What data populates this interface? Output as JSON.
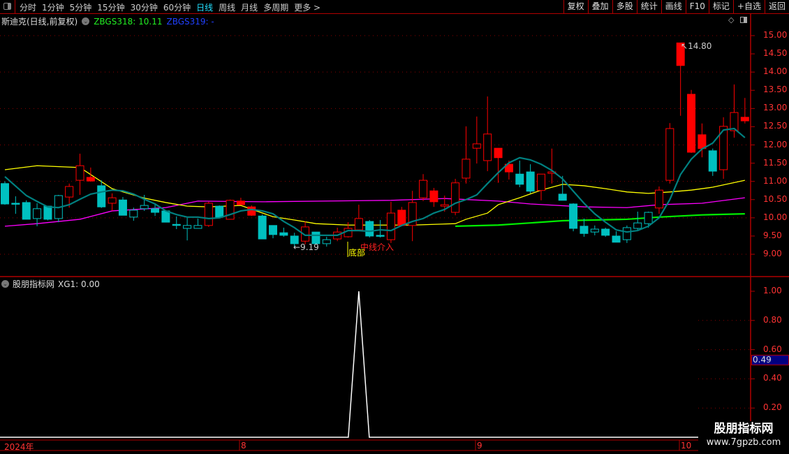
{
  "toolbar": {
    "periods": [
      "分时",
      "1分钟",
      "5分钟",
      "15分钟",
      "30分钟",
      "60分钟",
      "日线",
      "周线",
      "月线",
      "多周期",
      "更多 >"
    ],
    "active_period": "日线",
    "buttons": [
      "复权",
      "叠加",
      "多股",
      "统计",
      "画线",
      "F10",
      "标记",
      "+自选",
      "返回"
    ]
  },
  "main": {
    "stock_title": "斯迪克(日线,前复权)",
    "ind1": "ZBGS318: 10.11",
    "ind2": "ZBGS319: -",
    "high_label": "14.80",
    "low_label": "←9.19",
    "signal_bottom": "底部",
    "signal_mid": "中线介入"
  },
  "sub": {
    "title": "股朋指标网",
    "ind": "XG1: 0.00",
    "highlight_value": "0.49"
  },
  "dates": [
    "2024年",
    "8",
    "9",
    "10"
  ],
  "watermark": {
    "line1": "股朋指标网",
    "line2": "www.7gpzb.com"
  },
  "colors": {
    "up": "#ff0000",
    "down": "#00c0c0",
    "ma5": "#008080",
    "ma_yellow": "#ffff00",
    "ma_magenta": "#ff00ff",
    "ma_green": "#00ee00",
    "axis": "#b00000"
  },
  "chart_data": [
    {
      "type": "candlestick",
      "title": "斯迪克(日线,前复权)",
      "ylim": [
        8.6,
        15.3
      ],
      "yticks": [
        "15.00",
        "14.50",
        "14.00",
        "13.50",
        "13.00",
        "12.50",
        "12.00",
        "11.50",
        "11.00",
        "10.50",
        "10.00",
        "9.50",
        "9.00"
      ],
      "candles": [
        {
          "o": 10.94,
          "h": 11.0,
          "l": 10.36,
          "c": 10.38,
          "s": "cf"
        },
        {
          "o": 10.4,
          "h": 10.59,
          "l": 10.11,
          "c": 10.4,
          "s": "cf"
        },
        {
          "o": 10.42,
          "h": 10.48,
          "l": 9.96,
          "c": 9.96,
          "s": "cf"
        },
        {
          "o": 9.98,
          "h": 10.4,
          "l": 9.77,
          "c": 10.25,
          "s": "ch"
        },
        {
          "o": 10.32,
          "h": 10.32,
          "l": 9.93,
          "c": 9.96,
          "s": "cf"
        },
        {
          "o": 9.98,
          "h": 10.63,
          "l": 9.88,
          "c": 10.61,
          "s": "ch"
        },
        {
          "o": 10.57,
          "h": 10.94,
          "l": 10.28,
          "c": 10.86,
          "s": "rh"
        },
        {
          "o": 11.03,
          "h": 11.76,
          "l": 10.63,
          "c": 11.43,
          "s": "rh"
        },
        {
          "o": 11.11,
          "h": 11.38,
          "l": 10.99,
          "c": 11.01,
          "s": "rf"
        },
        {
          "o": 10.88,
          "h": 11.03,
          "l": 10.27,
          "c": 10.3,
          "s": "cf"
        },
        {
          "o": 10.4,
          "h": 10.67,
          "l": 10.19,
          "c": 10.55,
          "s": "rh"
        },
        {
          "o": 10.49,
          "h": 10.57,
          "l": 10.07,
          "c": 10.07,
          "s": "cf"
        },
        {
          "o": 10.02,
          "h": 10.28,
          "l": 9.92,
          "c": 10.21,
          "s": "ch"
        },
        {
          "o": 10.25,
          "h": 10.63,
          "l": 10.19,
          "c": 10.34,
          "s": "ch"
        },
        {
          "o": 10.25,
          "h": 10.4,
          "l": 10.05,
          "c": 10.15,
          "s": "cf"
        },
        {
          "o": 10.19,
          "h": 10.19,
          "l": 9.88,
          "c": 9.88,
          "s": "cf"
        },
        {
          "o": 9.82,
          "h": 10.04,
          "l": 9.69,
          "c": 9.82,
          "s": "cf"
        },
        {
          "o": 9.71,
          "h": 10.0,
          "l": 9.38,
          "c": 9.79,
          "s": "ch"
        },
        {
          "o": 9.71,
          "h": 9.98,
          "l": 9.71,
          "c": 9.79,
          "s": "ch"
        },
        {
          "o": 9.79,
          "h": 10.44,
          "l": 9.75,
          "c": 10.4,
          "s": "rh"
        },
        {
          "o": 10.32,
          "h": 10.34,
          "l": 10.02,
          "c": 10.02,
          "s": "cf"
        },
        {
          "o": 9.96,
          "h": 10.5,
          "l": 9.96,
          "c": 10.48,
          "s": "rh"
        },
        {
          "o": 10.46,
          "h": 10.55,
          "l": 10.36,
          "c": 10.36,
          "s": "rf"
        },
        {
          "o": 10.3,
          "h": 10.34,
          "l": 10.05,
          "c": 10.07,
          "s": "rf"
        },
        {
          "o": 10.05,
          "h": 10.09,
          "l": 9.42,
          "c": 9.42,
          "s": "cf"
        },
        {
          "o": 9.79,
          "h": 9.79,
          "l": 9.44,
          "c": 9.54,
          "s": "cf"
        },
        {
          "o": 9.59,
          "h": 9.73,
          "l": 9.48,
          "c": 9.52,
          "s": "cf"
        },
        {
          "o": 9.5,
          "h": 9.59,
          "l": 9.19,
          "c": 9.29,
          "s": "cf"
        },
        {
          "o": 9.36,
          "h": 9.9,
          "l": 9.27,
          "c": 9.75,
          "s": "rh"
        },
        {
          "o": 9.61,
          "h": 9.61,
          "l": 9.29,
          "c": 9.29,
          "s": "cf"
        },
        {
          "o": 9.29,
          "h": 9.48,
          "l": 9.21,
          "c": 9.4,
          "s": "ch"
        },
        {
          "o": 9.42,
          "h": 9.73,
          "l": 9.36,
          "c": 9.61,
          "s": "rh"
        },
        {
          "o": 9.48,
          "h": 9.88,
          "l": 9.46,
          "c": 9.71,
          "s": "rh"
        },
        {
          "o": 9.67,
          "h": 10.36,
          "l": 9.65,
          "c": 9.98,
          "s": "rh"
        },
        {
          "o": 9.9,
          "h": 9.94,
          "l": 9.46,
          "c": 9.5,
          "s": "cf"
        },
        {
          "o": 9.52,
          "h": 9.94,
          "l": 9.46,
          "c": 9.52,
          "s": "cf"
        },
        {
          "o": 9.4,
          "h": 10.44,
          "l": 9.31,
          "c": 10.13,
          "s": "rh"
        },
        {
          "o": 10.21,
          "h": 10.3,
          "l": 9.79,
          "c": 9.79,
          "s": "rf"
        },
        {
          "o": 9.79,
          "h": 10.74,
          "l": 9.36,
          "c": 10.42,
          "s": "rh"
        },
        {
          "o": 10.55,
          "h": 11.2,
          "l": 10.46,
          "c": 11.03,
          "s": "rh"
        },
        {
          "o": 10.74,
          "h": 10.82,
          "l": 10.3,
          "c": 10.44,
          "s": "rf"
        },
        {
          "o": 10.32,
          "h": 10.61,
          "l": 10.17,
          "c": 10.36,
          "s": "rh"
        },
        {
          "o": 10.15,
          "h": 11.07,
          "l": 10.07,
          "c": 10.96,
          "s": "rh"
        },
        {
          "o": 11.09,
          "h": 12.51,
          "l": 10.94,
          "c": 11.61,
          "s": "rh"
        },
        {
          "o": 11.91,
          "h": 12.78,
          "l": 11.49,
          "c": 12.03,
          "s": "rh"
        },
        {
          "o": 11.57,
          "h": 13.33,
          "l": 11.28,
          "c": 12.3,
          "s": "rh"
        },
        {
          "o": 11.91,
          "h": 11.91,
          "l": 10.96,
          "c": 11.65,
          "s": "rf"
        },
        {
          "o": 11.47,
          "h": 11.57,
          "l": 11.05,
          "c": 11.26,
          "s": "rf"
        },
        {
          "o": 11.2,
          "h": 11.57,
          "l": 10.84,
          "c": 10.92,
          "s": "cf"
        },
        {
          "o": 11.26,
          "h": 11.47,
          "l": 10.67,
          "c": 10.73,
          "s": "cf"
        },
        {
          "o": 10.75,
          "h": 11.2,
          "l": 10.48,
          "c": 11.2,
          "s": "rh"
        },
        {
          "o": 11.22,
          "h": 11.9,
          "l": 10.94,
          "c": 11.26,
          "s": "rh"
        },
        {
          "o": 10.65,
          "h": 11.15,
          "l": 10.48,
          "c": 10.48,
          "s": "cf"
        },
        {
          "o": 10.38,
          "h": 10.4,
          "l": 9.63,
          "c": 9.71,
          "s": "cf"
        },
        {
          "o": 9.77,
          "h": 9.98,
          "l": 9.48,
          "c": 9.57,
          "s": "cf"
        },
        {
          "o": 9.61,
          "h": 9.79,
          "l": 9.52,
          "c": 9.69,
          "s": "ch"
        },
        {
          "o": 9.69,
          "h": 9.73,
          "l": 9.48,
          "c": 9.52,
          "s": "cf"
        },
        {
          "o": 9.5,
          "h": 9.63,
          "l": 9.33,
          "c": 9.33,
          "s": "cf"
        },
        {
          "o": 9.4,
          "h": 9.79,
          "l": 9.31,
          "c": 9.73,
          "s": "ch"
        },
        {
          "o": 9.71,
          "h": 10.17,
          "l": 9.67,
          "c": 9.86,
          "s": "ch"
        },
        {
          "o": 9.84,
          "h": 10.17,
          "l": 9.73,
          "c": 10.15,
          "s": "ch"
        },
        {
          "o": 10.27,
          "h": 10.86,
          "l": 10.11,
          "c": 10.76,
          "s": "rh"
        },
        {
          "o": 11.03,
          "h": 12.6,
          "l": 10.94,
          "c": 12.45,
          "s": "rh"
        },
        {
          "o": 14.8,
          "h": 14.8,
          "l": 12.8,
          "c": 14.18,
          "s": "rf"
        },
        {
          "o": 13.39,
          "h": 13.51,
          "l": 11.78,
          "c": 11.8,
          "s": "rf"
        },
        {
          "o": 12.28,
          "h": 12.59,
          "l": 11.66,
          "c": 11.9,
          "s": "rf"
        },
        {
          "o": 11.84,
          "h": 11.9,
          "l": 11.15,
          "c": 11.28,
          "s": "cf"
        },
        {
          "o": 11.32,
          "h": 12.76,
          "l": 11.07,
          "c": 12.51,
          "s": "rh"
        },
        {
          "o": 12.39,
          "h": 13.66,
          "l": 12.2,
          "c": 12.89,
          "s": "rh"
        },
        {
          "o": 12.76,
          "h": 13.29,
          "l": 12.59,
          "c": 12.66,
          "s": "rf"
        }
      ],
      "ma_short": [
        11.13,
        10.87,
        10.61,
        10.45,
        10.3,
        10.28,
        10.36,
        10.51,
        10.65,
        10.71,
        10.76,
        10.74,
        10.65,
        10.51,
        10.38,
        10.19,
        10.09,
        10.02,
        10.02,
        9.98,
        10.0,
        10.09,
        10.19,
        10.23,
        10.19,
        10.11,
        9.9,
        9.73,
        9.52,
        9.52,
        9.52,
        9.52,
        9.65,
        9.65,
        9.63,
        9.67,
        9.65,
        9.79,
        9.9,
        9.98,
        10.13,
        10.23,
        10.4,
        10.5,
        10.63,
        10.94,
        11.24,
        11.51,
        11.65,
        11.59,
        11.47,
        11.3,
        11.07,
        10.73,
        10.4,
        10.11,
        9.88,
        9.67,
        9.61,
        9.65,
        9.77,
        10.0,
        10.5,
        11.19,
        11.61,
        11.89,
        12.05,
        12.41,
        12.45,
        12.2
      ],
      "ma_yellow": [
        [
          0,
          11.32
        ],
        [
          3,
          11.43
        ],
        [
          7,
          11.38
        ],
        [
          10,
          10.8
        ],
        [
          13,
          10.54
        ],
        [
          15,
          10.42
        ],
        [
          17,
          10.32
        ],
        [
          19,
          10.3
        ],
        [
          22,
          10.34
        ],
        [
          25,
          10.03
        ],
        [
          27,
          9.94
        ],
        [
          29,
          9.84
        ],
        [
          32,
          9.8
        ],
        [
          38,
          9.8
        ],
        [
          42,
          9.84
        ],
        [
          43,
          9.96
        ],
        [
          45,
          10.13
        ],
        [
          46,
          10.36
        ],
        [
          48,
          10.55
        ],
        [
          50,
          10.76
        ],
        [
          52,
          10.92
        ],
        [
          54,
          10.88
        ],
        [
          56,
          10.8
        ],
        [
          58,
          10.71
        ],
        [
          60,
          10.67
        ],
        [
          62,
          10.71
        ],
        [
          64,
          10.76
        ],
        [
          66,
          10.84
        ],
        [
          69,
          11.03
        ]
      ],
      "ma_magenta": [
        [
          0,
          9.77
        ],
        [
          3,
          9.84
        ],
        [
          7,
          9.96
        ],
        [
          10,
          10.19
        ],
        [
          15,
          10.28
        ],
        [
          18,
          10.46
        ],
        [
          24,
          10.44
        ],
        [
          36,
          10.48
        ],
        [
          41,
          10.53
        ],
        [
          46,
          10.46
        ],
        [
          49,
          10.38
        ],
        [
          54,
          10.3
        ],
        [
          58,
          10.28
        ],
        [
          61,
          10.36
        ],
        [
          65,
          10.4
        ],
        [
          69,
          10.55
        ]
      ],
      "ma_green": [
        [
          42,
          9.77
        ],
        [
          46,
          9.8
        ],
        [
          52,
          9.92
        ],
        [
          58,
          9.96
        ],
        [
          61,
          10.02
        ],
        [
          65,
          10.08
        ],
        [
          69,
          10.11
        ]
      ],
      "grid_levels": [
        15,
        14,
        13,
        12,
        11,
        10,
        9
      ]
    },
    {
      "type": "line",
      "title": "股朋指标网 XG1",
      "ylim": [
        0,
        1.05
      ],
      "yticks": [
        "1.00",
        "0.80",
        "0.60",
        "0.40",
        "0.20"
      ],
      "series": [
        {
          "name": "XG1",
          "spike_index": 33,
          "spike_value": 1.0,
          "baseline": 0
        }
      ]
    }
  ]
}
